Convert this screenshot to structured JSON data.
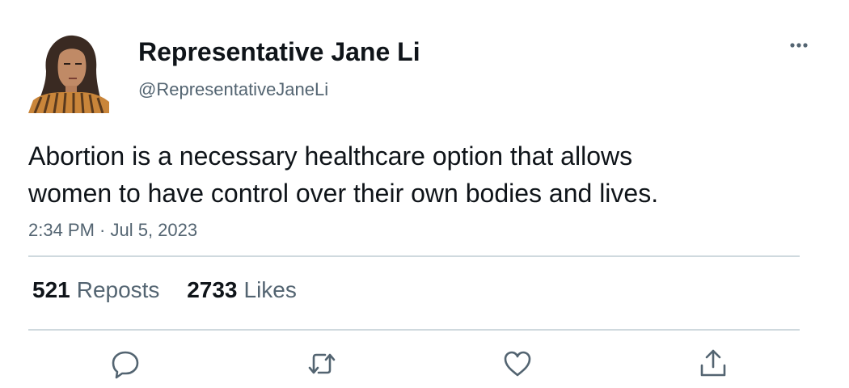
{
  "author": {
    "display_name": "Representative Jane Li",
    "handle": "@RepresentativeJaneLi"
  },
  "tweet": {
    "text_line1": "Abortion is a necessary healthcare option that allows",
    "text_line2": "women to have control over their own bodies and lives.",
    "timestamp": "2:34 PM · Jul 5, 2023"
  },
  "stats": {
    "reposts_count": "521",
    "reposts_label": "Reposts",
    "likes_count": "2733",
    "likes_label": "Likes"
  },
  "actions": [
    "reply-icon",
    "repost-icon",
    "like-icon",
    "share-icon"
  ],
  "colors": {
    "text": "#0f1419",
    "secondary": "#536471",
    "divider": "#cfd9de",
    "icon": "#536471"
  }
}
